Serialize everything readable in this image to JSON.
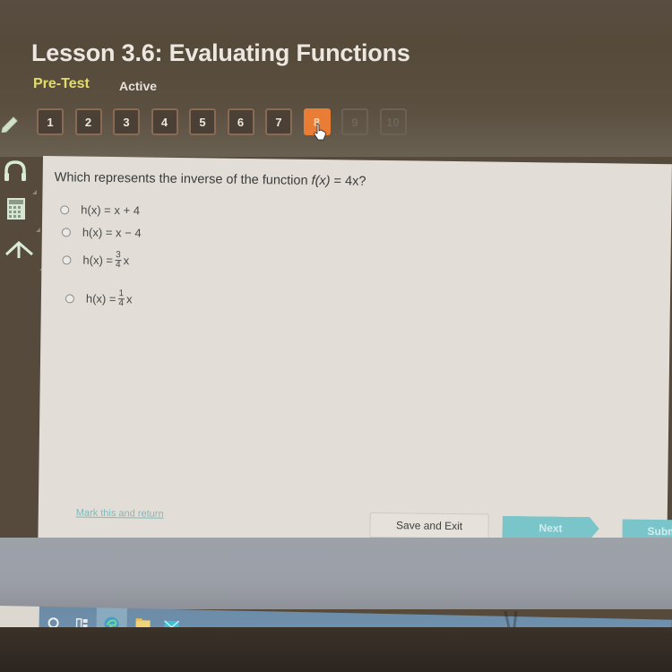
{
  "header": {
    "lesson_title": "Lesson 3.6: Evaluating Functions",
    "mode_label": "Pre-Test",
    "status_label": "Active"
  },
  "question_nav": {
    "buttons": [
      {
        "label": "1",
        "state": "answered"
      },
      {
        "label": "2",
        "state": "answered"
      },
      {
        "label": "3",
        "state": "answered"
      },
      {
        "label": "4",
        "state": "answered"
      },
      {
        "label": "5",
        "state": "answered"
      },
      {
        "label": "6",
        "state": "answered"
      },
      {
        "label": "7",
        "state": "answered"
      },
      {
        "label": "8",
        "state": "current"
      },
      {
        "label": "9",
        "state": "disabled"
      },
      {
        "label": "10",
        "state": "disabled"
      }
    ],
    "accent_color": "#ea7d35"
  },
  "side_tools": [
    {
      "icon": "pencil-icon"
    },
    {
      "icon": "headphones-icon"
    },
    {
      "icon": "calculator-icon"
    },
    {
      "icon": "collapse-up-icon"
    }
  ],
  "question": {
    "prefix": "Which represents the inverse of the function ",
    "function": "f(x)",
    "suffix": " = 4x?",
    "options": [
      {
        "lhs": "h(x) = ",
        "text": "x + 4"
      },
      {
        "lhs": "h(x) = ",
        "text": "x − 4"
      },
      {
        "lhs": "h(x) = ",
        "numerator": "3",
        "denominator": "4",
        "var": "x"
      },
      {
        "lhs": "h(x) = ",
        "numerator": "1",
        "denominator": "4",
        "var": "x"
      }
    ]
  },
  "footer": {
    "mark_link": "Mark this and return",
    "save_exit": "Save and Exit",
    "next": "Next",
    "submit": "Submit",
    "button_color": "#79c5c9"
  },
  "taskbar": {
    "icons": [
      "search-icon",
      "task-view-icon",
      "edge-browser-icon",
      "file-explorer-icon",
      "mail-icon"
    ]
  }
}
